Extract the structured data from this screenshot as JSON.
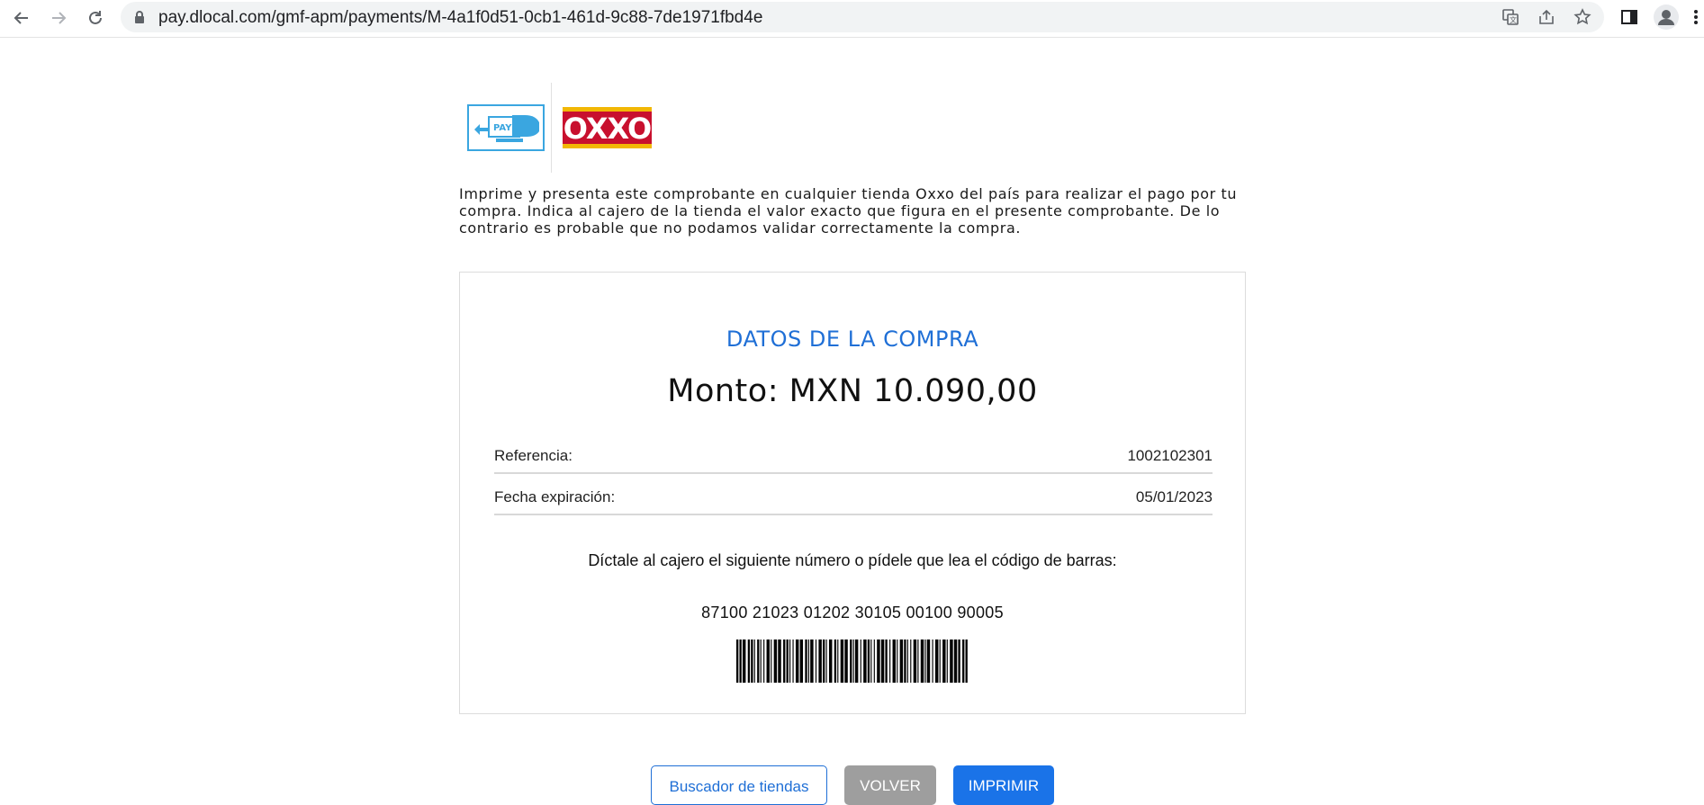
{
  "browser": {
    "url": "pay.dlocal.com/gmf-apm/payments/M-4a1f0d51-0cb1-461d-9c88-7de1971fbd4e",
    "icons": [
      "back-arrow-icon",
      "forward-arrow-icon",
      "reload-icon",
      "lock-icon",
      "translate-icon",
      "share-icon",
      "star-icon",
      "sidepanel-icon",
      "profile-icon",
      "kebab-menu-icon"
    ]
  },
  "logos": {
    "pay_text": "PAY",
    "oxxo_text": "OXXO",
    "colors": {
      "pay_blue": "#3aa6e0",
      "oxxo_red": "#c8102e",
      "oxxo_yellow": "#f2b705"
    }
  },
  "intro_text": "Imprime y presenta este comprobante en cualquier tienda Oxxo del país para realizar el pago por tu compra. Indica al cajero de la tienda el valor exacto que figura en el presente comprobante. De lo contrario es probable que no podamos validar correctamente la compra.",
  "card": {
    "title": "DATOS DE LA COMPRA",
    "amount": "Monto: MXN 10.090,00",
    "reference_label": "Referencia:",
    "reference_value": "1002102301",
    "expiry_label": "Fecha expiración:",
    "expiry_value": "05/01/2023",
    "instruction": "Díctale al cajero el siguiente número o pídele que lea el código de barras:",
    "barcode_number": "87100 21023 01202 30105 00100 90005"
  },
  "buttons": {
    "stores": "Buscador de tiendas",
    "back": "VOLVER",
    "print": "IMPRIMIR"
  },
  "colors": {
    "accent": "#1a73e8",
    "title_blue": "#1f6fd6",
    "button_gray": "#9e9e9e"
  }
}
